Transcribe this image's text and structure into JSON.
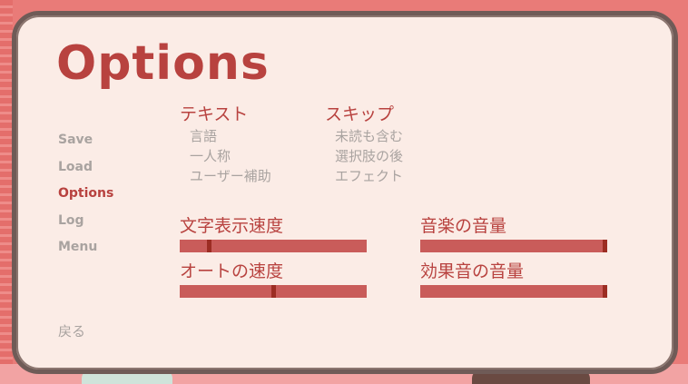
{
  "title": "Options",
  "nav": [
    {
      "label": "Save",
      "active": false
    },
    {
      "label": "Load",
      "active": false
    },
    {
      "label": "Options",
      "active": true
    },
    {
      "label": "Log",
      "active": false
    },
    {
      "label": "Menu",
      "active": false
    }
  ],
  "back_label": "戻る",
  "text_group": {
    "heading": "テキスト",
    "items": [
      "言語",
      "一人称",
      "ユーザー補助"
    ]
  },
  "skip_group": {
    "heading": "スキップ",
    "items": [
      "未読も含む",
      "選択肢の後",
      "エフェクト"
    ]
  },
  "sliders": {
    "text_speed": {
      "label": "文字表示速度",
      "value": 0.15
    },
    "auto_speed": {
      "label": "オートの速度",
      "value": 0.5
    },
    "music_volume": {
      "label": "音楽の音量",
      "value": 1.0
    },
    "sfx_volume": {
      "label": "効果音の音量",
      "value": 1.0
    }
  },
  "colors": {
    "accent": "#b8423f",
    "muted": "#a9a3a0",
    "panel": "#fbece6",
    "track": "#c95c5a",
    "thumb": "#9c2d23"
  }
}
